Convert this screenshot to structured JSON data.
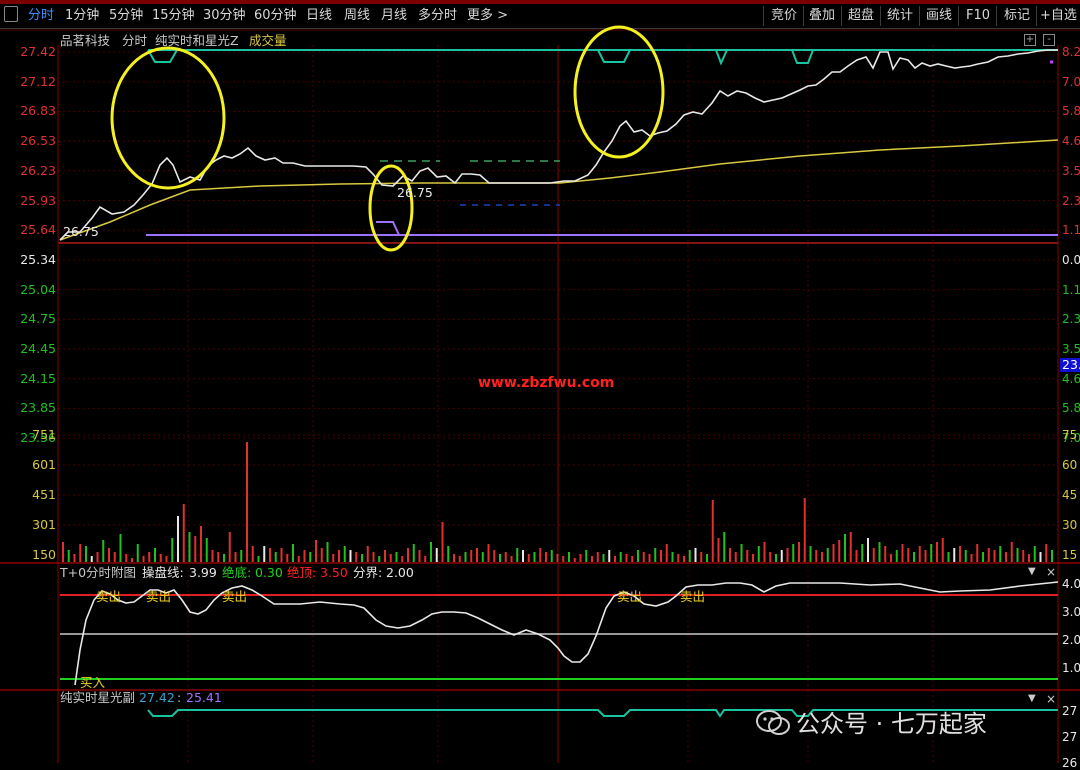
{
  "toolbar": {
    "tabs": [
      "分时",
      "1分钟",
      "5分钟",
      "15分钟",
      "30分钟",
      "60分钟",
      "日线",
      "周线",
      "月线",
      "多分时",
      "更多 >"
    ],
    "right": [
      "竞价",
      "叠加",
      "超盘",
      "统计",
      "画线",
      "F10",
      "标记",
      "+自选"
    ]
  },
  "header": {
    "stock": "品茗科技",
    "mode": "分时",
    "indicator": "纯实时和星光Z",
    "volume": "成交量"
  },
  "price_axis": [
    "27.42",
    "27.12",
    "26.83",
    "26.53",
    "26.23",
    "25.93",
    "25.64",
    "25.34",
    "25.04",
    "24.75",
    "24.45",
    "24.15",
    "23.85",
    "23.56"
  ],
  "right_axis": [
    "8.2",
    "7.0",
    "5.8",
    "4.6",
    "3.5",
    "2.3",
    "1.1",
    "0.0",
    "1.1",
    "2.3",
    "3.5",
    "4.6",
    "5.8",
    "7.0"
  ],
  "right_highlight": "23.",
  "volume_axis": [
    "751",
    "601",
    "451",
    "301",
    "150"
  ],
  "volume_right_axis": [
    "75",
    "60",
    "45",
    "30",
    "15"
  ],
  "labels": {
    "base_price": "26.75",
    "marker_price": "26.75",
    "watermark": "www.zbzfwu.com"
  },
  "t0": {
    "title": "T+0分时附图",
    "caopan_label": "操盘线:",
    "caopan_value": "3.99",
    "judi_label": "绝底:",
    "judi_value": "0.30",
    "jueding_label": "绝顶:",
    "jueding_value": "3.50",
    "fenjie_label": "分界:",
    "fenjie_value": "2.00",
    "sell": "卖出",
    "buy": "买入",
    "axis": [
      "4.0",
      "3.0",
      "2.0",
      "1.0"
    ]
  },
  "xg": {
    "title": "纯实时星光副",
    "v1": "27.42",
    "v2": "25.41",
    "axis": [
      "27",
      "27",
      "26"
    ]
  },
  "wechat": {
    "text": "公众号 · 七万起家"
  },
  "icons": {
    "panel": [
      "plus-icon",
      "minus-icon",
      "close-icon"
    ]
  }
}
